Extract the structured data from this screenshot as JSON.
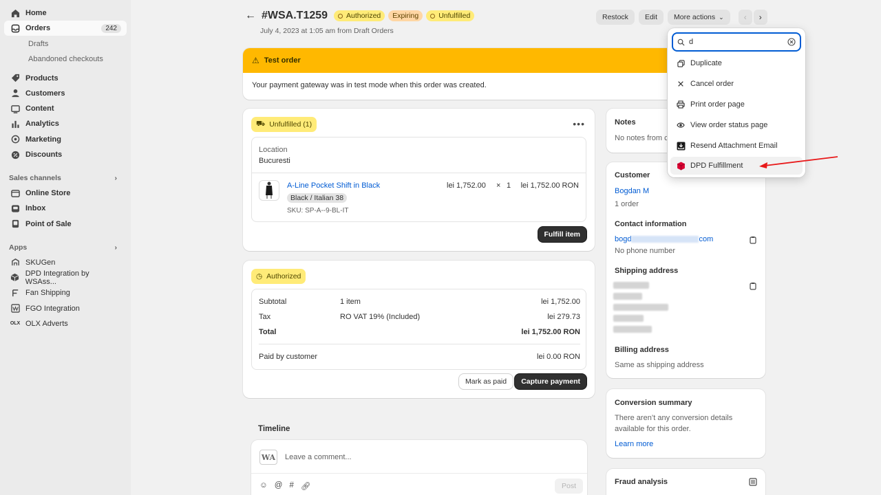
{
  "sidebar": {
    "items": [
      {
        "label": "Home",
        "icon": "home-icon"
      },
      {
        "label": "Orders",
        "icon": "orders-icon",
        "badge": "242"
      },
      {
        "label": "Drafts"
      },
      {
        "label": "Abandoned checkouts"
      },
      {
        "label": "Products",
        "icon": "tag-icon"
      },
      {
        "label": "Customers",
        "icon": "person-icon"
      },
      {
        "label": "Content",
        "icon": "content-icon"
      },
      {
        "label": "Analytics",
        "icon": "bar-chart-icon"
      },
      {
        "label": "Marketing",
        "icon": "target-icon"
      },
      {
        "label": "Discounts",
        "icon": "discount-icon"
      }
    ],
    "sales_channels_label": "Sales channels",
    "channels": [
      {
        "label": "Online Store",
        "icon": "store-icon"
      },
      {
        "label": "Inbox",
        "icon": "inbox-icon"
      },
      {
        "label": "Point of Sale",
        "icon": "pos-icon"
      }
    ],
    "apps_label": "Apps",
    "apps": [
      {
        "label": "SKUGen",
        "icon": "skugen-icon"
      },
      {
        "label": "DPD Integration by WSAss...",
        "icon": "dpd-icon"
      },
      {
        "label": "Fan Shipping",
        "icon": "fan-icon"
      },
      {
        "label": "FGO Integration",
        "icon": "fgo-icon"
      },
      {
        "label": "OLX Adverts",
        "icon": "olx-icon"
      }
    ]
  },
  "header": {
    "order_id": "#WSA.T1259",
    "badges": [
      "Authorized",
      "Expiring",
      "Unfulfilled"
    ],
    "subtitle": "July 4, 2023 at 1:05 am from Draft Orders",
    "actions": [
      "Restock",
      "Edit",
      "More actions"
    ]
  },
  "banner": {
    "title": "Test order",
    "body": "Your payment gateway was in test mode when this order was created."
  },
  "unfulfilled": {
    "pill": "Unfulfilled (1)",
    "location_label": "Location",
    "location_value": "Bucuresti",
    "product_name": "A-Line Pocket Shift in Black",
    "variant": "Black / Italian 38",
    "sku": "SKU: SP-A--9-BL-IT",
    "unit_price": "lei  1,752.00",
    "times": "×",
    "qty": "1",
    "total": "lei 1,752.00 RON",
    "fulfill_button": "Fulfill item"
  },
  "payment": {
    "pill": "Authorized",
    "rows": [
      {
        "label": "Subtotal",
        "detail": "1 item",
        "amount": "lei 1,752.00"
      },
      {
        "label": "Tax",
        "detail": "RO VAT 19% (Included)",
        "amount": "lei 279.73"
      },
      {
        "label": "Total",
        "detail": "",
        "amount": "lei 1,752.00 RON"
      }
    ],
    "paid_label": "Paid by customer",
    "paid_amount": "lei 0.00 RON",
    "mark_paid": "Mark as paid",
    "capture": "Capture payment"
  },
  "timeline": {
    "title": "Timeline",
    "placeholder": "Leave a comment...",
    "post": "Post",
    "avatar": "WA"
  },
  "notes": {
    "title": "Notes",
    "text": "No notes from c"
  },
  "customer": {
    "title": "Customer",
    "name": "Bogdan M",
    "orders": "1 order",
    "contact_title": "Contact information",
    "email_start": "bogd",
    "email_end": "com",
    "phone": "No phone number",
    "shipping_title": "Shipping address",
    "billing_title": "Billing address",
    "billing_text": "Same as shipping address"
  },
  "conversion": {
    "title": "Conversion summary",
    "text1": "There aren’t any conversion details",
    "text2": "available for this order.",
    "link": "Learn more"
  },
  "fraud": {
    "title": "Fraud analysis"
  },
  "dropdown": {
    "search_value": "d",
    "items": [
      {
        "label": "Duplicate",
        "icon": "duplicate-icon"
      },
      {
        "label": "Cancel order",
        "icon": "close-icon"
      },
      {
        "label": "Print order page",
        "icon": "printer-icon"
      },
      {
        "label": "View order status page",
        "icon": "eye-icon"
      },
      {
        "label": "Resend Attachment Email",
        "icon": "download-box-icon"
      },
      {
        "label": "DPD Fulfillment",
        "icon": "dpd-cube-icon"
      }
    ]
  },
  "colors": {
    "accent": "#005bd3",
    "banner": "#ffb800",
    "badge_yellow": "#ffeb78",
    "badge_orange": "#ffd6a4",
    "annotation_arrow": "#e8191a"
  }
}
